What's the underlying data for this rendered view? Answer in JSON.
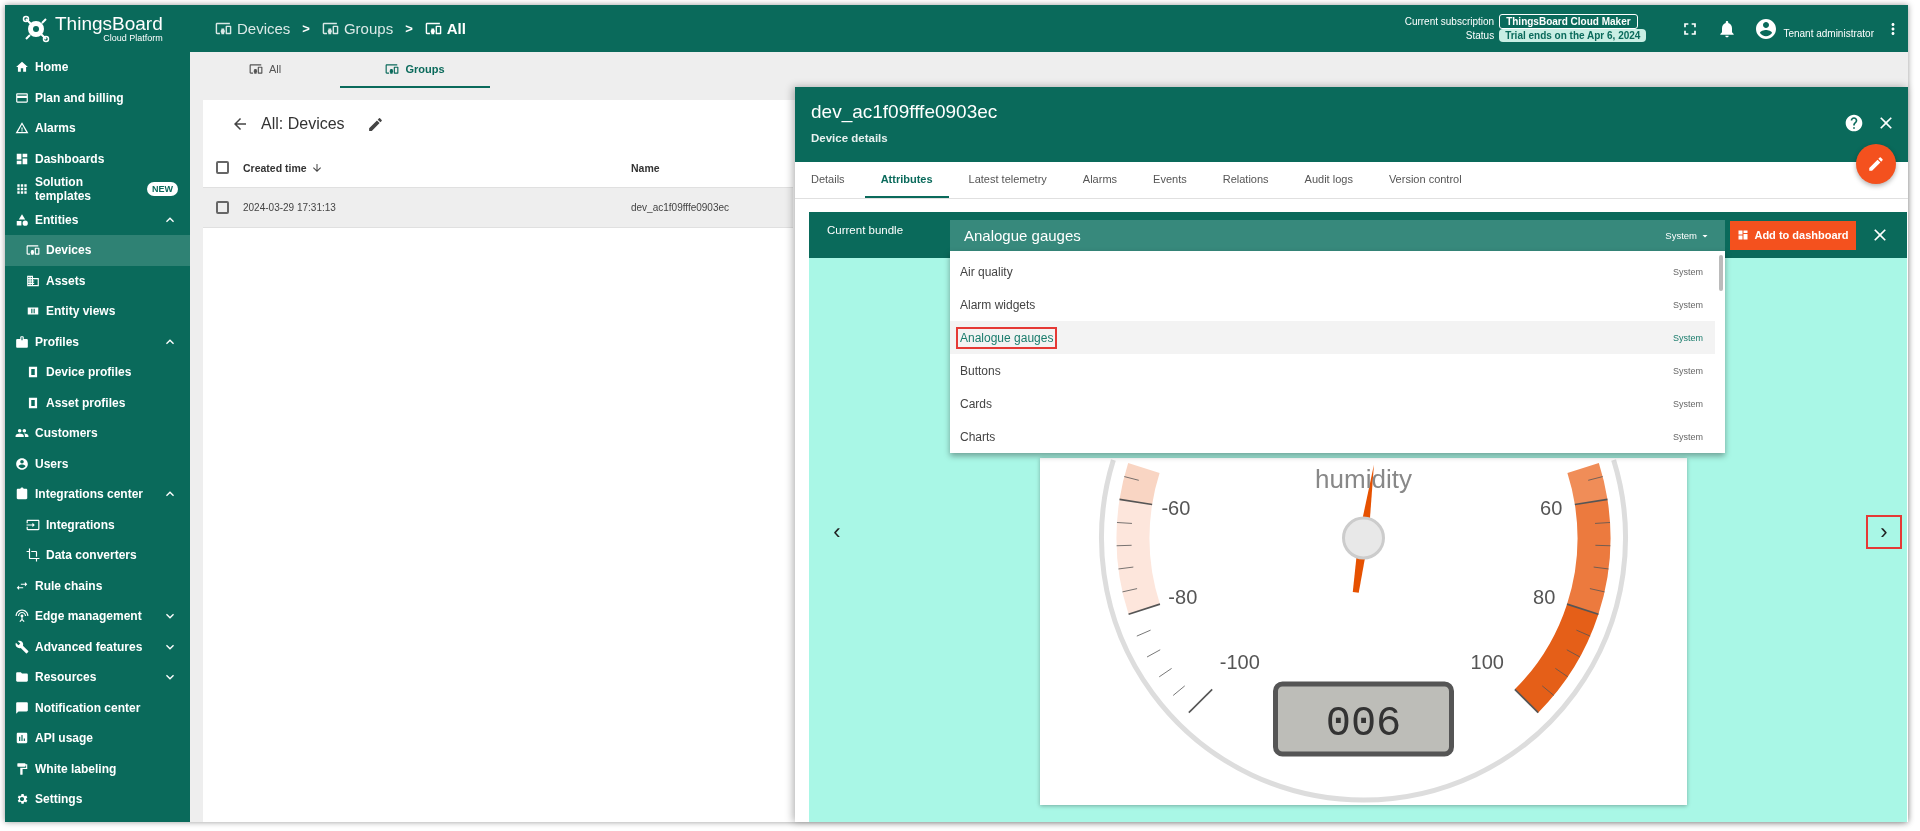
{
  "header": {
    "logo": {
      "name": "ThingsBoard",
      "subtitle": "Cloud Platform"
    },
    "separator": ">",
    "breadcrumbs": [
      {
        "label": "Devices"
      },
      {
        "label": "Groups"
      },
      {
        "label": "All"
      }
    ],
    "subscription": {
      "label": "Current subscription",
      "value": "ThingsBoard Cloud Maker"
    },
    "status": {
      "label": "Status",
      "value": "Trial ends on the Apr 6, 2024"
    },
    "user": {
      "role": "Tenant administrator"
    }
  },
  "sidebar": {
    "items": [
      {
        "label": "Home",
        "selected": false
      },
      {
        "label": "Plan and billing",
        "selected": false
      },
      {
        "label": "Alarms",
        "selected": false
      },
      {
        "label": "Dashboards",
        "selected": false
      },
      {
        "label": "Solution templates",
        "selected": false,
        "badge": "NEW"
      },
      {
        "label": "Entities",
        "selected": false,
        "expanded": true,
        "children": [
          {
            "label": "Devices",
            "selected": true
          },
          {
            "label": "Assets",
            "selected": false
          },
          {
            "label": "Entity views",
            "selected": false
          }
        ]
      },
      {
        "label": "Profiles",
        "selected": false,
        "expanded": true,
        "children": [
          {
            "label": "Device profiles",
            "selected": false
          },
          {
            "label": "Asset profiles",
            "selected": false
          }
        ]
      },
      {
        "label": "Customers",
        "selected": false
      },
      {
        "label": "Users",
        "selected": false
      },
      {
        "label": "Integrations center",
        "selected": false,
        "expanded": true,
        "children": [
          {
            "label": "Integrations",
            "selected": false
          },
          {
            "label": "Data converters",
            "selected": false
          }
        ]
      },
      {
        "label": "Rule chains",
        "selected": false
      },
      {
        "label": "Edge management",
        "selected": false,
        "expanded": false
      },
      {
        "label": "Advanced features",
        "selected": false,
        "expanded": false
      },
      {
        "label": "Resources",
        "selected": false,
        "expanded": false
      },
      {
        "label": "Notification center",
        "selected": false
      },
      {
        "label": "API usage",
        "selected": false
      },
      {
        "label": "White labeling",
        "selected": false
      },
      {
        "label": "Settings",
        "selected": false
      }
    ]
  },
  "tabs": [
    {
      "label": "All",
      "selected": false
    },
    {
      "label": "Groups",
      "selected": true
    }
  ],
  "list": {
    "title": "All: Devices",
    "all_checked": false,
    "columns": [
      {
        "label": "Created time",
        "sorted": true
      },
      {
        "label": "Name",
        "sorted": false
      }
    ],
    "rows": [
      {
        "created_time": "2024-03-29 17:31:13",
        "name": "dev_ac1f09fffe0903ec",
        "checked": false,
        "selected": true
      }
    ]
  },
  "details": {
    "title": "dev_ac1f09fffe0903ec",
    "subtitle": "Device details",
    "tabs": [
      {
        "label": "Details",
        "selected": false
      },
      {
        "label": "Attributes",
        "selected": true
      },
      {
        "label": "Latest telemetry",
        "selected": false
      },
      {
        "label": "Alarms",
        "selected": false
      },
      {
        "label": "Events",
        "selected": false
      },
      {
        "label": "Relations",
        "selected": false
      },
      {
        "label": "Audit logs",
        "selected": false
      },
      {
        "label": "Version control",
        "selected": false
      }
    ],
    "bundle": {
      "label": "Current bundle",
      "value": "Analogue gauges",
      "scope": "System",
      "add_button": "Add to dashboard",
      "options": [
        {
          "label": "Air quality",
          "scope": "System",
          "selected": false,
          "highlighted": false
        },
        {
          "label": "Alarm widgets",
          "scope": "System",
          "selected": false,
          "highlighted": false
        },
        {
          "label": "Analogue gauges",
          "scope": "System",
          "selected": true,
          "highlighted": true
        },
        {
          "label": "Buttons",
          "scope": "System",
          "selected": false,
          "highlighted": false
        },
        {
          "label": "Cards",
          "scope": "System",
          "selected": false,
          "highlighted": false
        },
        {
          "label": "Charts",
          "scope": "System",
          "selected": false,
          "highlighted": false
        }
      ]
    },
    "widget": {
      "title": "humidity",
      "labels": [
        "-60",
        "-80",
        "-100",
        "60",
        "80",
        "100"
      ],
      "display": "006",
      "level": 0.53
    },
    "prev": {
      "label": "‹",
      "highlighted": false
    },
    "next": {
      "label": "›",
      "highlighted": true
    }
  }
}
